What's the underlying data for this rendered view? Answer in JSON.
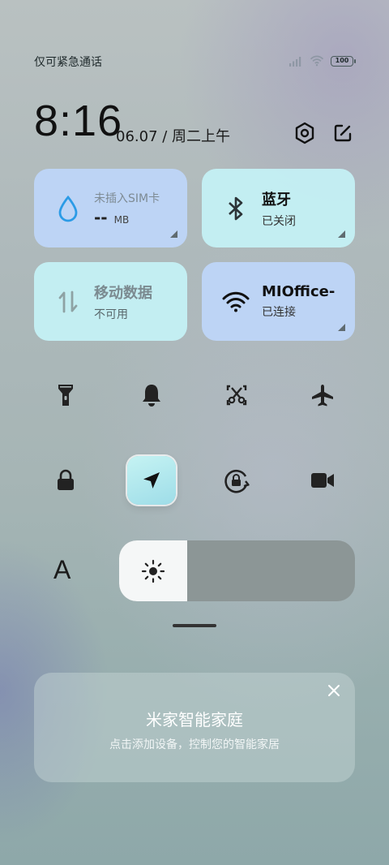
{
  "status": {
    "carrier": "仅可紧急通话",
    "battery": "100"
  },
  "clock": {
    "time": "8:16",
    "date": "06.07 / 周二上午"
  },
  "tiles": {
    "sim": {
      "title": "未插入SIM卡",
      "value": "--",
      "unit": "MB"
    },
    "bluetooth": {
      "title": "蓝牙",
      "status": "已关闭"
    },
    "mobile_data": {
      "title": "移动数据",
      "status": "不可用"
    },
    "wifi": {
      "title": "MIOffice-",
      "status": "已连接"
    }
  },
  "brightness": {
    "level": 0.29
  },
  "font_label": "A",
  "mijia": {
    "title": "米家智能家庭",
    "subtitle": "点击添加设备，控制您的智能家居"
  },
  "colors": {
    "tile_blue": "#bed6fa",
    "tile_cyan": "#c4f2f6",
    "active_toggle": "#9edde8"
  }
}
